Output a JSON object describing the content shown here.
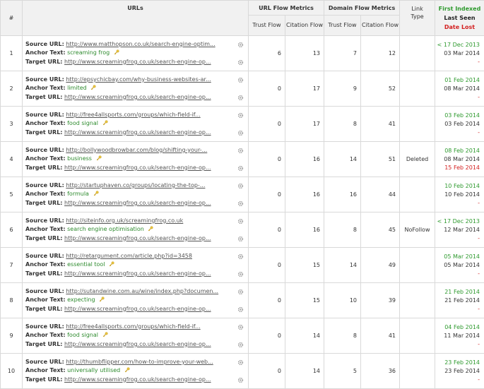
{
  "header": {
    "num": "#",
    "urls": "URLs",
    "url_flow": "URL Flow Metrics",
    "domain_flow": "Domain Flow Metrics",
    "link_type": "Link Type",
    "first_indexed": "First Indexed",
    "last_seen": "Last Seen",
    "date_lost": "Date Lost",
    "trust_flow": "Trust Flow",
    "citation_flow": "Citation Flow",
    "d_trust_flow": "Trust Flow",
    "d_citation_flow": "Citation Flow"
  },
  "labels": {
    "source": "Source URL:",
    "anchor": "Anchor Text:",
    "target": "Target URL:"
  },
  "rows": [
    {
      "n": "1",
      "source": "http://www.matthopson.co.uk/search-engine-optim...",
      "anchor": "screaming frog",
      "target": "http://www.screamingfrog.co.uk/search-engine-op...",
      "utf": "6",
      "ucf": "13",
      "dtf": "7",
      "dcf": "12",
      "type": "",
      "first": "< 17 Dec 2013",
      "last": "03 Mar 2014",
      "lost": "-"
    },
    {
      "n": "2",
      "source": "http://epsychicbay.com/why-business-websites-ar...",
      "anchor": "limited",
      "target": "http://www.screamingfrog.co.uk/search-engine-op...",
      "utf": "0",
      "ucf": "17",
      "dtf": "9",
      "dcf": "52",
      "type": "",
      "first": "01 Feb 2014",
      "last": "08 Mar 2014",
      "lost": "-"
    },
    {
      "n": "3",
      "source": "http://free4allsports.com/groups/which-field-if...",
      "anchor": "food signal",
      "target": "http://www.screamingfrog.co.uk/search-engine-op...",
      "utf": "0",
      "ucf": "17",
      "dtf": "8",
      "dcf": "41",
      "type": "",
      "first": "03 Feb 2014",
      "last": "03 Feb 2014",
      "lost": "-"
    },
    {
      "n": "4",
      "source": "http://bollywoodbrowbar.com/blog/shifting-your-...",
      "anchor": "business",
      "target": "http://www.screamingfrog.co.uk/search-engine-op...",
      "utf": "0",
      "ucf": "16",
      "dtf": "14",
      "dcf": "51",
      "type": "Deleted",
      "first": "08 Feb 2014",
      "last": "08 Mar 2014",
      "lost": "15 Feb 2014"
    },
    {
      "n": "5",
      "source": "http://startuphaven.co/groups/locating-the-top-...",
      "anchor": "formula",
      "target": "http://www.screamingfrog.co.uk/search-engine-op...",
      "utf": "0",
      "ucf": "16",
      "dtf": "16",
      "dcf": "44",
      "type": "",
      "first": "10 Feb 2014",
      "last": "10 Feb 2014",
      "lost": "-"
    },
    {
      "n": "6",
      "source": "http://siteinfo.org.uk/screamingfrog.co.uk",
      "anchor": "search engine optimisation",
      "target": "http://www.screamingfrog.co.uk/search-engine-op...",
      "utf": "0",
      "ucf": "16",
      "dtf": "8",
      "dcf": "45",
      "type": "NoFollow",
      "first": "< 17 Dec 2013",
      "last": "12 Mar 2014",
      "lost": "-"
    },
    {
      "n": "7",
      "source": "http://retargument.com/article.php?id=3458",
      "anchor": "essential tool",
      "target": "http://www.screamingfrog.co.uk/search-engine-op...",
      "utf": "0",
      "ucf": "15",
      "dtf": "14",
      "dcf": "49",
      "type": "",
      "first": "05 Mar 2014",
      "last": "05 Mar 2014",
      "lost": "-"
    },
    {
      "n": "8",
      "source": "http://sutandwine.com.au/wine/index.php?documen...",
      "anchor": "expecting",
      "target": "http://www.screamingfrog.co.uk/search-engine-op...",
      "utf": "0",
      "ucf": "15",
      "dtf": "10",
      "dcf": "39",
      "type": "",
      "first": "21 Feb 2014",
      "last": "21 Feb 2014",
      "lost": "-"
    },
    {
      "n": "9",
      "source": "http://free4allsports.com/groups/which-field-if...",
      "anchor": "food signal",
      "target": "http://www.screamingfrog.co.uk/search-engine-op...",
      "utf": "0",
      "ucf": "14",
      "dtf": "8",
      "dcf": "41",
      "type": "",
      "first": "04 Feb 2014",
      "last": "11 Mar 2014",
      "lost": "-"
    },
    {
      "n": "10",
      "source": "http://thumbflipper.com/how-to-improve-your-web...",
      "anchor": "universally utilised",
      "target": "http://www.screamingfrog.co.uk/search-engine-op...",
      "utf": "0",
      "ucf": "14",
      "dtf": "5",
      "dcf": "36",
      "type": "",
      "first": "23 Feb 2014",
      "last": "23 Feb 2014",
      "lost": "-"
    }
  ],
  "colors": {
    "green": "#2e9a2e",
    "red": "#d32020",
    "header_bg": "#f1f1f1",
    "border": "#d9d9d9"
  },
  "icons": {
    "edit": "key-icon",
    "settings": "gear-icon"
  }
}
